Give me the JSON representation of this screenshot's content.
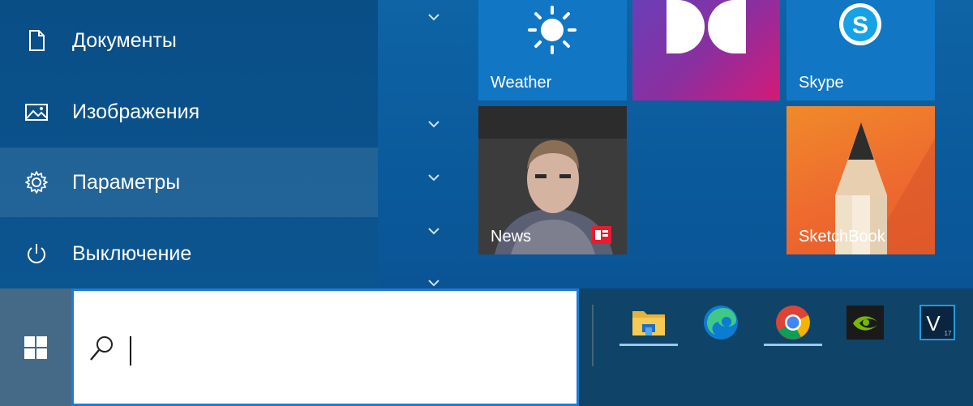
{
  "start_menu": {
    "left_items": [
      {
        "label": "Документы",
        "icon": "document-icon"
      },
      {
        "label": "Изображения",
        "icon": "pictures-icon"
      },
      {
        "label": "Параметры",
        "icon": "gear-icon"
      },
      {
        "label": "Выключение",
        "icon": "power-icon"
      }
    ],
    "tiles": {
      "weather": {
        "label": "Weather",
        "icon": "sun-icon"
      },
      "dolby": {
        "icon": "dolby-logo"
      },
      "skype": {
        "label": "Skype",
        "icon": "skype-logo"
      },
      "news": {
        "label": "News",
        "icon": "news-badge-icon"
      },
      "sketchbook": {
        "label": "SketchBook",
        "icon": "pencil-icon"
      }
    }
  },
  "taskbar": {
    "search": {
      "value": "",
      "placeholder": ""
    },
    "apps": [
      {
        "name": "File Explorer",
        "icon": "folder-icon",
        "running": true
      },
      {
        "name": "Microsoft Edge",
        "icon": "edge-icon",
        "running": false
      },
      {
        "name": "Google Chrome",
        "icon": "chrome-icon",
        "running": true
      },
      {
        "name": "NVIDIA",
        "icon": "nvidia-icon",
        "running": false
      },
      {
        "name": "V",
        "icon": "v-app-icon",
        "running": false
      }
    ]
  },
  "colors": {
    "accent": "#1f7ad6",
    "taskbar": "#0f4368",
    "start_button": "#446a88"
  }
}
